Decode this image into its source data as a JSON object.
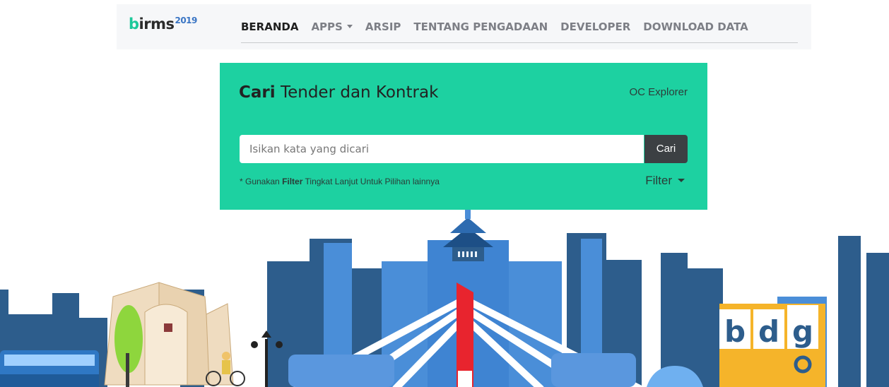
{
  "brand": {
    "name_b": "b",
    "name_rest": "irms",
    "year": "2019"
  },
  "nav": {
    "items": [
      {
        "label": "BERANDA"
      },
      {
        "label": "APPS"
      },
      {
        "label": "ARSIP"
      },
      {
        "label": "TENTANG PENGADAAN"
      },
      {
        "label": "DEVELOPER"
      },
      {
        "label": "DOWNLOAD DATA"
      }
    ]
  },
  "search": {
    "title_bold": "Cari",
    "title_rest": "Tender dan Kontrak",
    "oc_explorer": "OC Explorer",
    "placeholder": "Isikan kata yang dicari",
    "button": "Cari",
    "hint_prefix": "* Gunakan",
    "hint_bold": "Filter",
    "hint_suffix": "Tingkat Lanjut Untuk Pilihan lainnya",
    "filter_label": "Filter"
  },
  "illustration": {
    "sign_letters": [
      "b",
      "d",
      "g"
    ]
  },
  "colors": {
    "accent": "#1dd1a1",
    "brand_blue": "#3a75c4",
    "dark_button": "#3c4043",
    "sky_blue": "#4a8ed8",
    "dark_building": "#2d5d8c"
  }
}
